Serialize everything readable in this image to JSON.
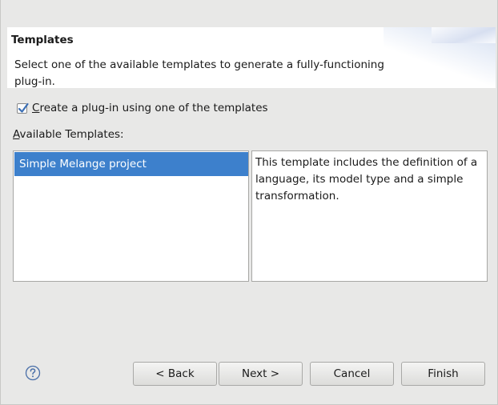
{
  "header": {
    "title": "Templates",
    "description": "Select one of the available templates to generate a fully-functioning plug-in."
  },
  "options": {
    "use_template_checked": true,
    "use_template_label_mnemonic": "C",
    "use_template_label_rest": "reate a plug-in using one of the templates"
  },
  "templates": {
    "label_mnemonic": "A",
    "label_rest": "vailable Templates:",
    "items": [
      "Simple Melange project"
    ],
    "selected_index": 0,
    "description": "This template includes the definition of a language, its model type and a simple transformation."
  },
  "buttons": {
    "help_icon": "question-circle-icon",
    "back": "< Back",
    "next": "Next >",
    "cancel": "Cancel",
    "finish": "Finish"
  },
  "colors": {
    "selection": "#3d80cc",
    "background": "#e8e8e7"
  }
}
